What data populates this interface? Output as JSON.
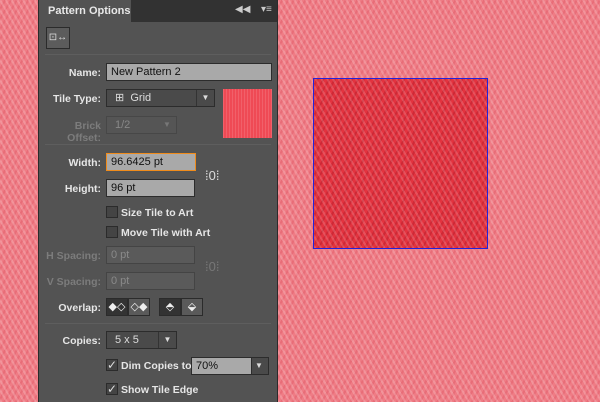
{
  "panel": {
    "title": "Pattern Options",
    "collapse_icon": "double-chevron-left-icon",
    "menu_icon": "panel-menu-icon"
  },
  "tool": {
    "icon": "pattern-tile-tool-icon"
  },
  "name": {
    "label": "Name:",
    "value": "New Pattern 2"
  },
  "tile_type": {
    "label": "Tile Type:",
    "value": "Grid",
    "icon": "grid-icon"
  },
  "brick_offset": {
    "label": "Brick Offset:",
    "value": "1/2"
  },
  "width": {
    "label": "Width:",
    "value": "96.6425 pt"
  },
  "height": {
    "label": "Height:",
    "value": "96 pt"
  },
  "size_tile_to_art": {
    "label": "Size Tile to Art",
    "checked": false
  },
  "move_tile_with_art": {
    "label": "Move Tile with Art",
    "checked": false
  },
  "h_spacing": {
    "label": "H Spacing:",
    "value": "0 pt"
  },
  "v_spacing": {
    "label": "V Spacing:",
    "value": "0 pt"
  },
  "overlap": {
    "label": "Overlap:"
  },
  "copies": {
    "label": "Copies:",
    "value": "5 x 5"
  },
  "dim_copies": {
    "label": "Dim Copies to:",
    "checked": true,
    "value": "70%"
  },
  "show_tile_edge": {
    "label": "Show Tile Edge",
    "checked": true
  },
  "colors": {
    "tile": "#e3333f",
    "background": "#ef7c85",
    "tile_edge": "#2222dd",
    "accent": "#f08c1c"
  }
}
